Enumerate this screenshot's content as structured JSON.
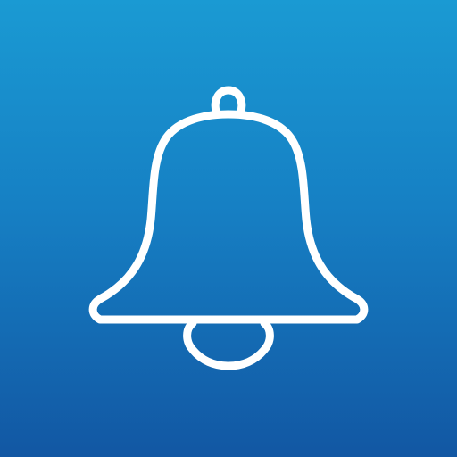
{
  "icon": {
    "name": "bell-icon",
    "stroke_color": "#ffffff",
    "background_top": "#1a9ad3",
    "background_bottom": "#1257a3"
  }
}
